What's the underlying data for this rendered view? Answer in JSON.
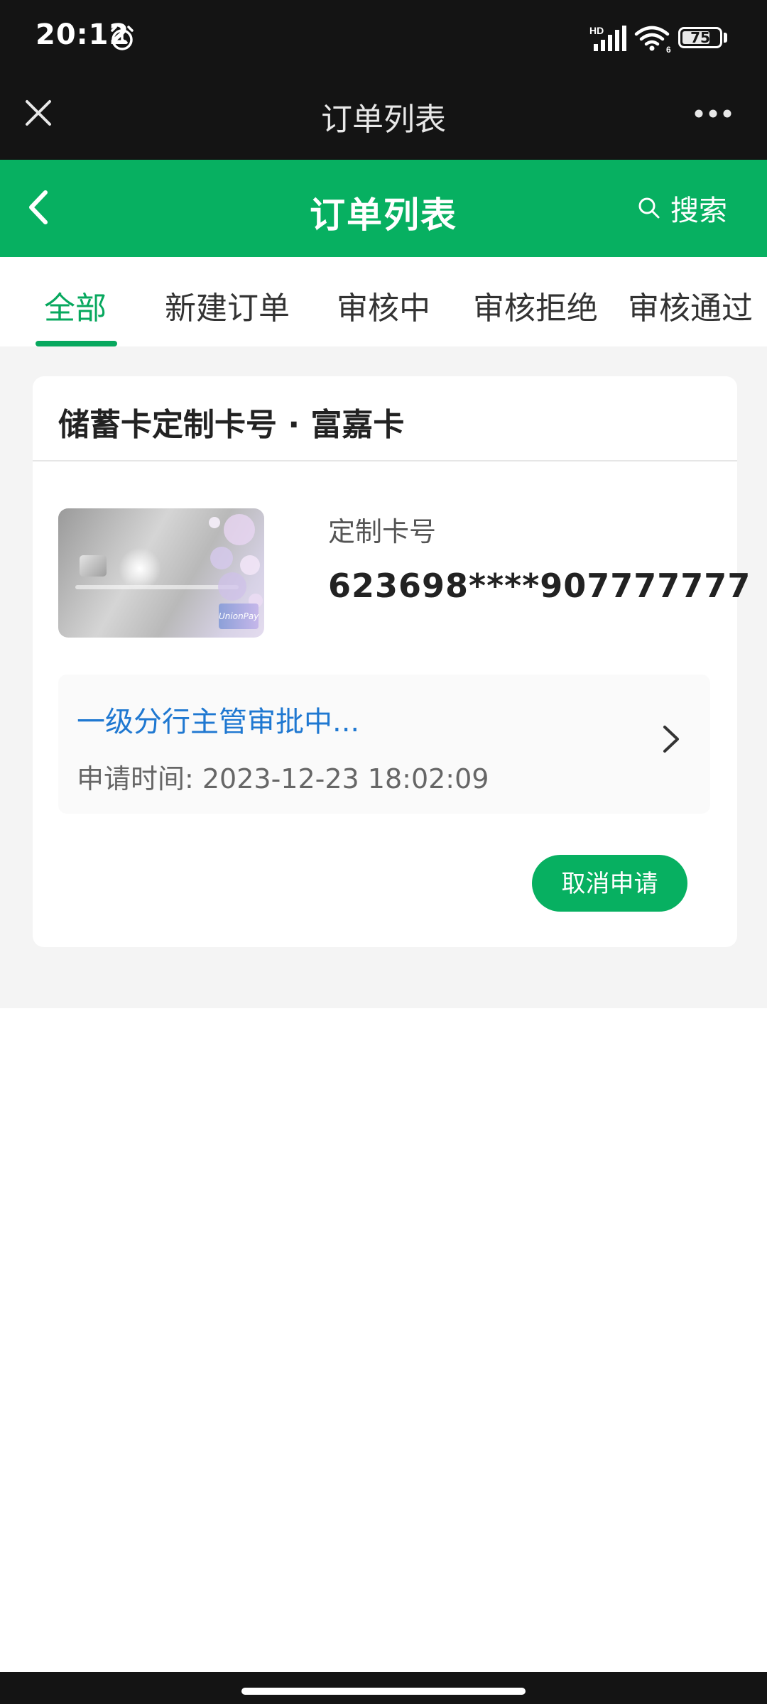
{
  "status_bar": {
    "time": "20:12",
    "network": "HD",
    "wifi_sub": "6",
    "battery": "75",
    "battery_level": 0.75
  },
  "wechat_header": {
    "title": "订单列表",
    "close_icon": "close-icon",
    "more_icon": "more-icon"
  },
  "app_header": {
    "title": "订单列表",
    "search_label": "搜索",
    "back_icon": "chevron-left-icon",
    "color": "#07b061"
  },
  "tabs": [
    {
      "label": "全部",
      "active": true
    },
    {
      "label": "新建订单",
      "active": false
    },
    {
      "label": "审核中",
      "active": false
    },
    {
      "label": "审核拒绝",
      "active": false
    },
    {
      "label": "审核通过",
      "active": false
    }
  ],
  "order": {
    "title": "储蓄卡定制卡号 · 富嘉卡",
    "card_label": "定制卡号",
    "card_number": "623698****907777777",
    "status": "一级分行主管审批中...",
    "apply_time": "申请时间: 2023-12-23 18:02:09",
    "cancel_label": "取消申请"
  },
  "colors": {
    "accent": "#07b061",
    "status_blue": "#1f78d1"
  }
}
